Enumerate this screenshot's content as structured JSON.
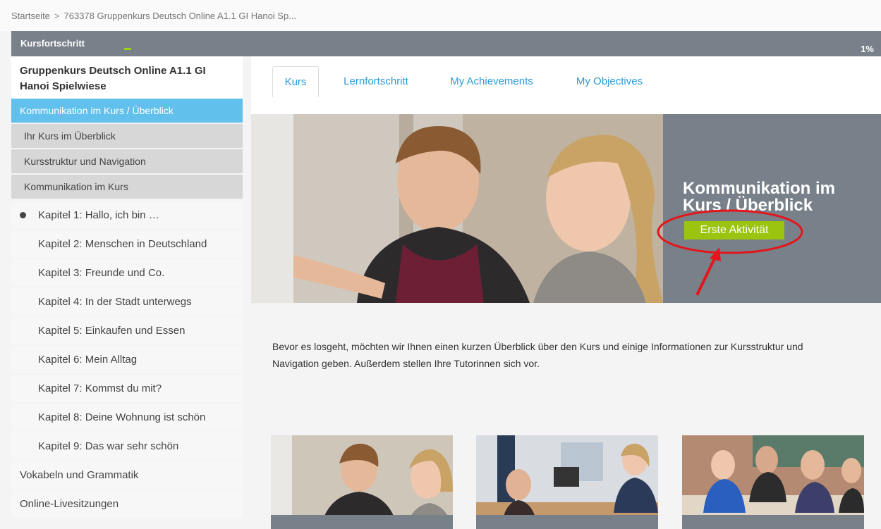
{
  "breadcrumb": {
    "home": "Startseite",
    "separator": ">",
    "current": "763378 Gruppenkurs Deutsch Online A1.1 GI Hanoi Sp..."
  },
  "progress": {
    "label": "Kursfortschritt",
    "percent_text": "1%",
    "value_percent": 1
  },
  "sidebar": {
    "course_title": "Gruppenkurs Deutsch Online A1.1 GI Hanoi Spielwiese",
    "active_section": "Kommunikation im Kurs / Überblick",
    "sub_items": [
      "Ihr Kurs im Überblick",
      "Kursstruktur und Navigation",
      "Kommunikation im Kurs"
    ],
    "chapters": [
      "Kapitel 1: Hallo, ich bin …",
      "Kapitel 2: Menschen in Deutschland",
      "Kapitel 3: Freunde und Co.",
      "Kapitel 4: In der Stadt unterwegs",
      "Kapitel 5: Einkaufen und Essen",
      "Kapitel 6: Mein Alltag",
      "Kapitel 7: Kommst du mit?",
      "Kapitel 8: Deine Wohnung ist schön",
      "Kapitel 9: Das war sehr schön"
    ],
    "extra_items": [
      "Vokabeln und Grammatik",
      "Online-Livesitzungen"
    ]
  },
  "tabs": [
    "Kurs",
    "Lernfortschritt",
    "My Achievements",
    "My Objectives"
  ],
  "hero": {
    "title": "Kommunikation im Kurs / Überblick",
    "button_label": "Erste Aktivität",
    "annotation_color": "#e3161c"
  },
  "intro_text": "Bevor es losgeht, möchten wir Ihnen einen kurzen Überblick über den Kurs und einige Informationen zur Kursstruktur und Navigation geben. Außerdem stellen Ihre Tutorinnen sich vor.",
  "colors": {
    "accent_blue": "#61c0ec",
    "link_blue": "#2b9ad8",
    "panel_grey": "#78818a",
    "button_green": "#9ac40f"
  }
}
